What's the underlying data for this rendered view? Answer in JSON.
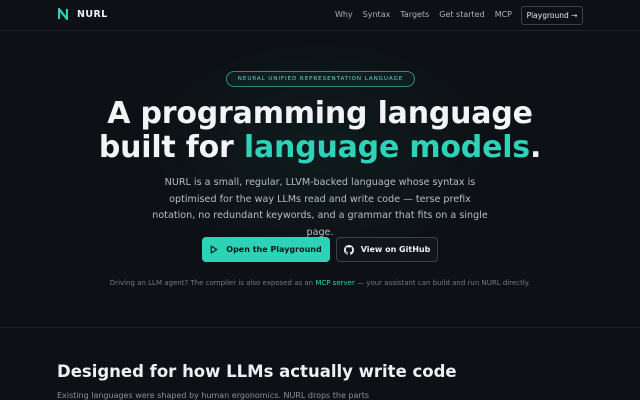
{
  "nav": {
    "brand": "NURL",
    "links": [
      "Why",
      "Syntax",
      "Targets",
      "Get started",
      "MCP"
    ],
    "cta": "Playground →"
  },
  "hero": {
    "badge": "NEURAL UNIFIED REPRESENTATION LANGUAGE",
    "headline_line1": "A programming language",
    "headline_line2_prefix": "built for ",
    "headline_line2_accent": "language models",
    "headline_line2_suffix": ".",
    "lead": "NURL is a small, regular, LLVM-backed language whose syntax is optimised for the way LLMs read and write code — terse prefix notation, no redundant keywords, and a grammar that fits on a single page.",
    "primary_button": "Open the Playground",
    "secondary_button": "View on GitHub",
    "note_prefix": "Driving an LLM agent? The compiler is also exposed as an ",
    "note_link": "MCP server",
    "note_suffix": " — your assistant can build and run NURL directly."
  },
  "section": {
    "title": "Designed for how LLMs actually write code",
    "subtitle": "Existing languages were shaped by human ergonomics. NURL drops the parts"
  },
  "colors": {
    "accent": "#2ed3b7",
    "background": "#0d1014"
  },
  "icons": {
    "logo": "logo-n-icon",
    "play": "play-icon",
    "github": "github-icon"
  }
}
